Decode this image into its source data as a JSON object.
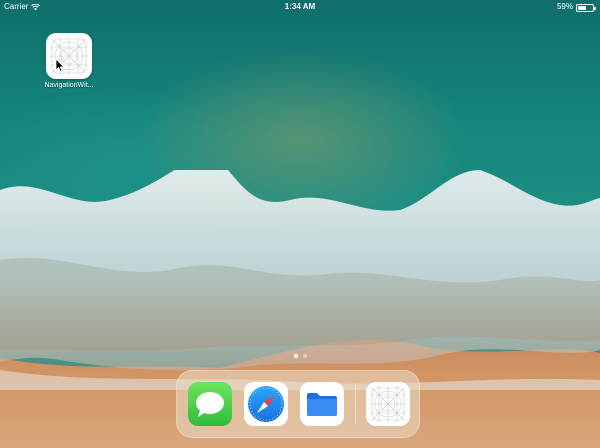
{
  "status_bar": {
    "carrier": "Carrier",
    "time": "1:34 AM",
    "battery_percent": "59%",
    "battery_level": 0.59,
    "wifi_icon": "wifi-icon",
    "battery_icon": "battery-icon"
  },
  "home_screen": {
    "apps": [
      {
        "label": "NavigationWit...",
        "icon": "app-placeholder-icon"
      }
    ],
    "page_count": 2,
    "active_page": 1
  },
  "dock": {
    "apps": [
      {
        "name": "Messages",
        "icon": "messages-icon"
      },
      {
        "name": "Safari",
        "icon": "safari-compass-icon"
      },
      {
        "name": "Files",
        "icon": "files-folder-icon"
      }
    ],
    "recent_apps": [
      {
        "name": "NavigationWit...",
        "icon": "app-placeholder-icon"
      }
    ]
  },
  "colors": {
    "ocean": "#15847b",
    "sand": "#c8875a",
    "surf": "#e8eef0",
    "messages_green": "#2fbd3b",
    "safari_blue": "#1b8cf0",
    "files_blue": "#2d7ff2"
  },
  "pointer": {
    "icon": "mouse-pointer-icon"
  }
}
